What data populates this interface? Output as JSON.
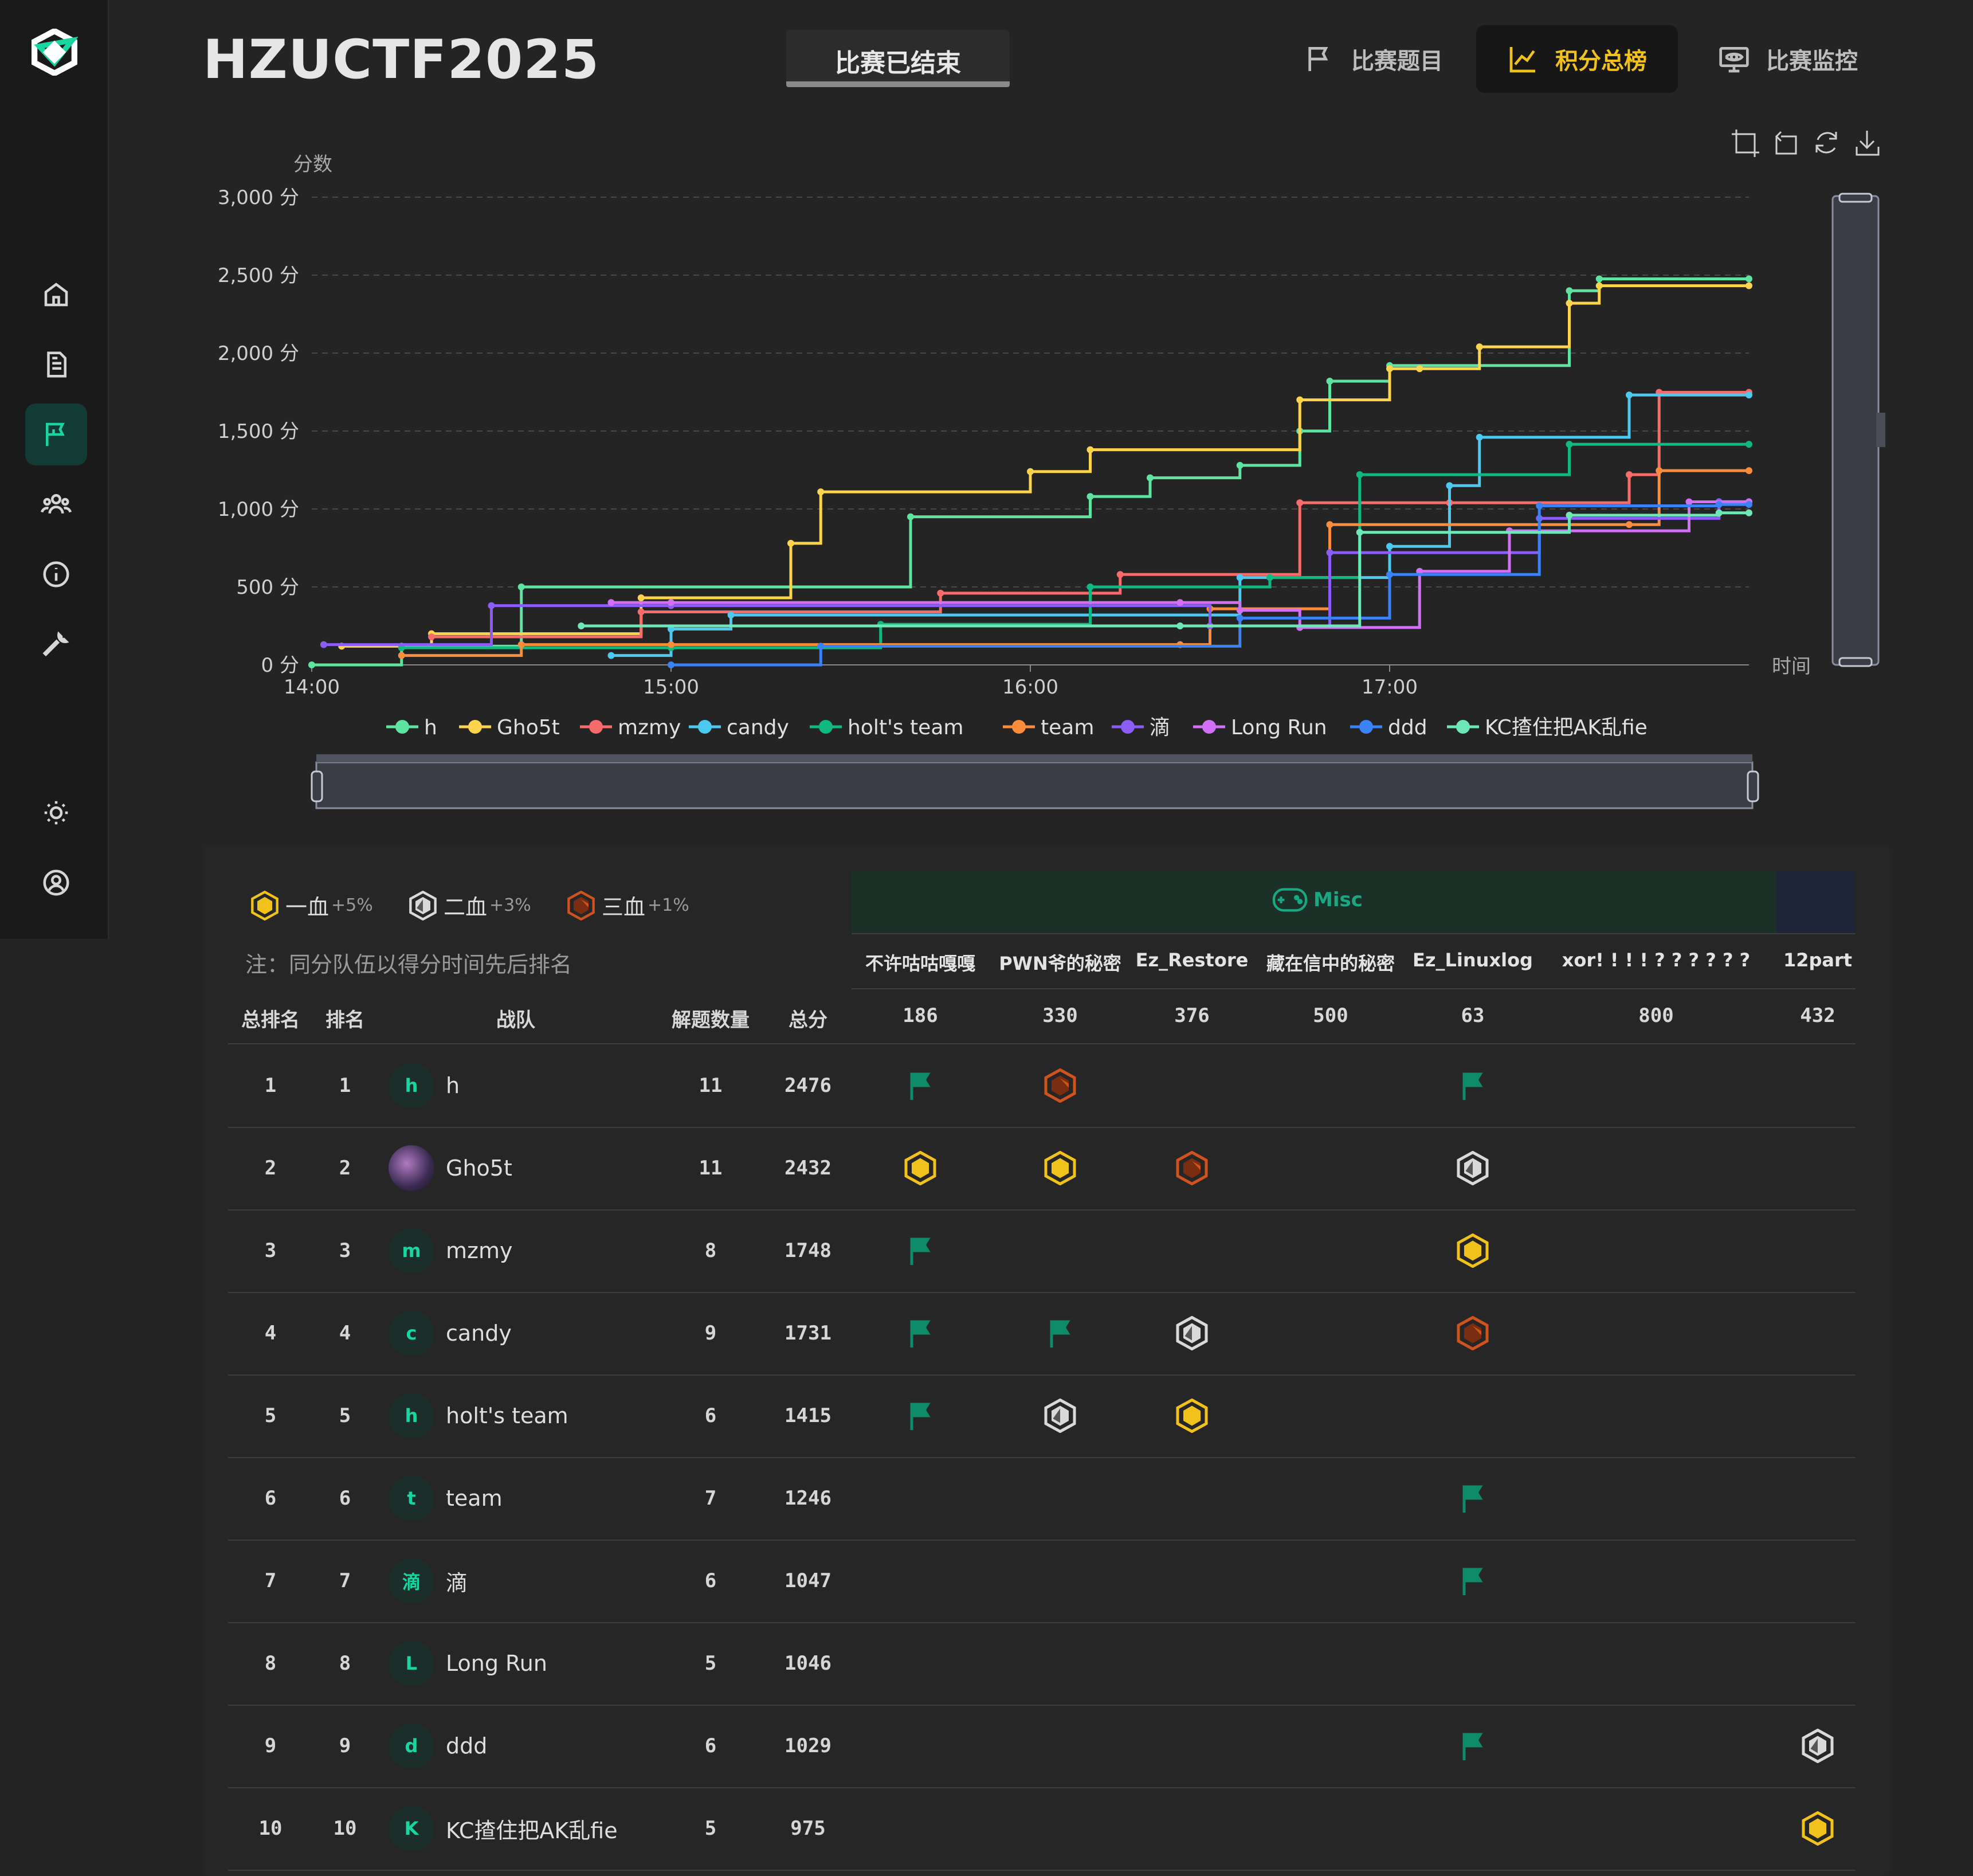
{
  "app": {
    "title": "HZUCTF2025",
    "status": "比赛已结束"
  },
  "nav": {
    "challenges": "比赛题目",
    "scoreboard": "积分总榜",
    "monitor": "比赛监控"
  },
  "sidebar": {
    "items": [
      "home-icon",
      "document-icon",
      "flag-icon",
      "team-icon",
      "info-icon",
      "wrench-icon"
    ],
    "bottom": [
      "brightness-icon",
      "user-circle-icon"
    ]
  },
  "colors": {
    "accent": "#19d6a0",
    "gold": "#f1c21b",
    "silver": "#d9d9d9",
    "bronze": "#d0521d",
    "flag": "#0e8c6a"
  },
  "chart_data": {
    "type": "line",
    "ylabel": "分数",
    "xlabel": "时间",
    "y_ticks": [
      "0 分",
      "500 分",
      "1,000 分",
      "1,500 分",
      "2,000 分",
      "2,500 分",
      "3,000 分"
    ],
    "x_ticks": [
      "14:00",
      "15:00",
      "16:00",
      "17:00"
    ],
    "ylim": [
      0,
      3000
    ],
    "xlim": [
      "14:00",
      "18:00"
    ],
    "step": true,
    "grid": "horizontal dashed",
    "legend_position": "bottom",
    "series": [
      {
        "name": "h",
        "color": "#5fe3a1",
        "points": [
          [
            "14:00",
            0
          ],
          [
            "14:15",
            120
          ],
          [
            "14:35",
            500
          ],
          [
            "15:40",
            950
          ],
          [
            "16:10",
            1080
          ],
          [
            "16:20",
            1200
          ],
          [
            "16:35",
            1280
          ],
          [
            "16:45",
            1500
          ],
          [
            "16:50",
            1820
          ],
          [
            "17:00",
            1920
          ],
          [
            "17:30",
            2400
          ],
          [
            "17:35",
            2476
          ],
          [
            "18:00",
            2476
          ]
        ]
      },
      {
        "name": "Gho5t",
        "color": "#fcd34d",
        "points": [
          [
            "14:05",
            120
          ],
          [
            "14:20",
            200
          ],
          [
            "14:55",
            430
          ],
          [
            "15:20",
            780
          ],
          [
            "15:25",
            1110
          ],
          [
            "16:00",
            1240
          ],
          [
            "16:10",
            1380
          ],
          [
            "16:45",
            1700
          ],
          [
            "17:00",
            1900
          ],
          [
            "17:05",
            1900
          ],
          [
            "17:15",
            2040
          ],
          [
            "17:30",
            2320
          ],
          [
            "17:35",
            2432
          ],
          [
            "18:00",
            2432
          ]
        ]
      },
      {
        "name": "mzmy",
        "color": "#f76b6b",
        "points": [
          [
            "14:20",
            180
          ],
          [
            "14:55",
            340
          ],
          [
            "15:45",
            460
          ],
          [
            "16:15",
            580
          ],
          [
            "16:45",
            1040
          ],
          [
            "17:10",
            1040
          ],
          [
            "17:40",
            1220
          ],
          [
            "17:45",
            1748
          ],
          [
            "18:00",
            1748
          ]
        ]
      },
      {
        "name": "candy",
        "color": "#4cc9f0",
        "points": [
          [
            "14:50",
            60
          ],
          [
            "15:00",
            230
          ],
          [
            "15:10",
            320
          ],
          [
            "16:35",
            560
          ],
          [
            "17:00",
            760
          ],
          [
            "17:10",
            1150
          ],
          [
            "17:15",
            1460
          ],
          [
            "17:40",
            1731
          ],
          [
            "18:00",
            1731
          ]
        ]
      },
      {
        "name": "holt's team",
        "color": "#10b981",
        "points": [
          [
            "14:15",
            110
          ],
          [
            "15:00",
            110
          ],
          [
            "15:35",
            260
          ],
          [
            "16:10",
            500
          ],
          [
            "16:40",
            560
          ],
          [
            "16:55",
            1220
          ],
          [
            "17:30",
            1415
          ],
          [
            "18:00",
            1415
          ]
        ]
      },
      {
        "name": "team",
        "color": "#fb8c3c",
        "points": [
          [
            "14:15",
            60
          ],
          [
            "14:35",
            130
          ],
          [
            "15:00",
            130
          ],
          [
            "16:25",
            130
          ],
          [
            "16:30",
            360
          ],
          [
            "16:50",
            900
          ],
          [
            "17:40",
            900
          ],
          [
            "17:45",
            1246
          ],
          [
            "18:00",
            1246
          ]
        ]
      },
      {
        "name": "滴",
        "color": "#8b5cf6",
        "points": [
          [
            "14:02",
            130
          ],
          [
            "14:30",
            380
          ],
          [
            "15:00",
            380
          ],
          [
            "16:30",
            250
          ],
          [
            "16:50",
            720
          ],
          [
            "17:25",
            940
          ],
          [
            "17:55",
            1047
          ],
          [
            "18:00",
            1047
          ]
        ]
      },
      {
        "name": "Long Run",
        "color": "#d270f5",
        "points": [
          [
            "14:50",
            400
          ],
          [
            "15:00",
            400
          ],
          [
            "16:25",
            400
          ],
          [
            "16:35",
            350
          ],
          [
            "16:45",
            240
          ],
          [
            "17:05",
            600
          ],
          [
            "17:20",
            860
          ],
          [
            "17:50",
            1046
          ],
          [
            "18:00",
            1046
          ]
        ]
      },
      {
        "name": "ddd",
        "color": "#3b82f6",
        "points": [
          [
            "15:00",
            0
          ],
          [
            "15:25",
            120
          ],
          [
            "16:35",
            300
          ],
          [
            "17:00",
            580
          ],
          [
            "17:25",
            1020
          ],
          [
            "17:55",
            1029
          ],
          [
            "18:00",
            1029
          ]
        ]
      },
      {
        "name": "KC揸住把AK乱fie",
        "color": "#6ee7b7",
        "points": [
          [
            "14:45",
            250
          ],
          [
            "16:25",
            250
          ],
          [
            "16:55",
            850
          ],
          [
            "17:30",
            960
          ],
          [
            "17:55",
            975
          ],
          [
            "18:00",
            975
          ]
        ]
      }
    ]
  },
  "board": {
    "blood": [
      {
        "label": "一血",
        "bonus": "+5%"
      },
      {
        "label": "二血",
        "bonus": "+3%"
      },
      {
        "label": "三血",
        "bonus": "+1%"
      }
    ],
    "note": "注：同分队伍以得分时间先后排名",
    "headers": {
      "overall": "总排名",
      "rank": "排名",
      "team": "战队",
      "solved": "解题数量",
      "total": "总分"
    },
    "category": "Misc",
    "challenges": [
      {
        "name": "不许咕咕嘎嘎",
        "score": "186"
      },
      {
        "name": "PWN爷的秘密",
        "score": "330"
      },
      {
        "name": "Ez_Restore",
        "score": "376"
      },
      {
        "name": "藏在信中的秘密",
        "score": "500"
      },
      {
        "name": "Ez_Linuxlog",
        "score": "63"
      },
      {
        "name": "xor! ! ! ! ? ? ? ? ? ?",
        "score": "800"
      },
      {
        "name": "12part",
        "score": "432"
      }
    ],
    "rows": [
      {
        "overall": "1",
        "rank": "1",
        "avatar": "h",
        "team": "h",
        "solved": "11",
        "total": "2476",
        "solves": [
          "flag",
          "bronze",
          "",
          "",
          "flag",
          "",
          ""
        ]
      },
      {
        "overall": "2",
        "rank": "2",
        "avatar": "",
        "team": "Gho5t",
        "solved": "11",
        "total": "2432",
        "solves": [
          "gold",
          "gold",
          "bronze",
          "",
          "silver",
          "",
          ""
        ]
      },
      {
        "overall": "3",
        "rank": "3",
        "avatar": "m",
        "team": "mzmy",
        "solved": "8",
        "total": "1748",
        "solves": [
          "flag",
          "",
          "",
          "",
          "gold",
          "",
          ""
        ]
      },
      {
        "overall": "4",
        "rank": "4",
        "avatar": "c",
        "team": "candy",
        "solved": "9",
        "total": "1731",
        "solves": [
          "flag",
          "flag",
          "silver",
          "",
          "bronze",
          "",
          ""
        ]
      },
      {
        "overall": "5",
        "rank": "5",
        "avatar": "h",
        "team": "holt's team",
        "solved": "6",
        "total": "1415",
        "solves": [
          "flag",
          "silver",
          "gold",
          "",
          "",
          "",
          ""
        ]
      },
      {
        "overall": "6",
        "rank": "6",
        "avatar": "t",
        "team": "team",
        "solved": "7",
        "total": "1246",
        "solves": [
          "",
          "",
          "",
          "",
          "flag",
          "",
          ""
        ]
      },
      {
        "overall": "7",
        "rank": "7",
        "avatar": "滴",
        "team": "滴",
        "solved": "6",
        "total": "1047",
        "solves": [
          "",
          "",
          "",
          "",
          "flag",
          "",
          ""
        ]
      },
      {
        "overall": "8",
        "rank": "8",
        "avatar": "L",
        "team": "Long Run",
        "solved": "5",
        "total": "1046",
        "solves": [
          "",
          "",
          "",
          "",
          "",
          "",
          ""
        ]
      },
      {
        "overall": "9",
        "rank": "9",
        "avatar": "d",
        "team": "ddd",
        "solved": "6",
        "total": "1029",
        "solves": [
          "",
          "",
          "",
          "",
          "flag",
          "",
          "silver"
        ]
      },
      {
        "overall": "10",
        "rank": "10",
        "avatar": "K",
        "team": "KC揸住把AK乱fie",
        "solved": "5",
        "total": "975",
        "solves": [
          "",
          "",
          "",
          "",
          "",
          "",
          "gold"
        ]
      }
    ]
  }
}
